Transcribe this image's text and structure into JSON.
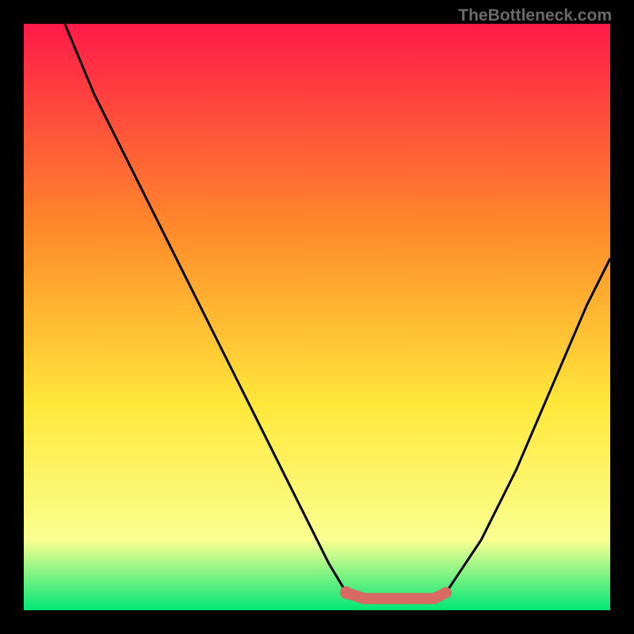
{
  "watermark": "TheBottleneck.com",
  "colors": {
    "gradient_top": "#ff1a4a",
    "gradient_mid1": "#ff8a2a",
    "gradient_mid2": "#ffe83a",
    "gradient_mid3": "#faff90",
    "gradient_bottom": "#00e676",
    "curve": "#000000",
    "flat_segment": "#d96a63",
    "flat_dot": "#d96a63"
  },
  "chart_data": {
    "type": "line",
    "title": "",
    "xlabel": "",
    "ylabel": "",
    "xlim": [
      0,
      100
    ],
    "ylim": [
      0,
      100
    ],
    "grid": false,
    "legend": false,
    "series": [
      {
        "name": "bottleneck-curve-left",
        "x": [
          7,
          12,
          18,
          24,
          30,
          36,
          42,
          48,
          52,
          55
        ],
        "values": [
          100,
          88,
          76,
          64,
          52,
          40,
          28,
          16,
          8,
          3
        ]
      },
      {
        "name": "flat-minimum",
        "x": [
          55,
          58,
          62,
          66,
          70,
          72
        ],
        "values": [
          3,
          2,
          2,
          2,
          2,
          3
        ]
      },
      {
        "name": "bottleneck-curve-right",
        "x": [
          72,
          78,
          84,
          90,
          96,
          100
        ],
        "values": [
          3,
          12,
          24,
          38,
          52,
          60
        ]
      }
    ],
    "annotations": [
      {
        "name": "flat-start-dot",
        "x": 55,
        "y": 3
      }
    ]
  }
}
